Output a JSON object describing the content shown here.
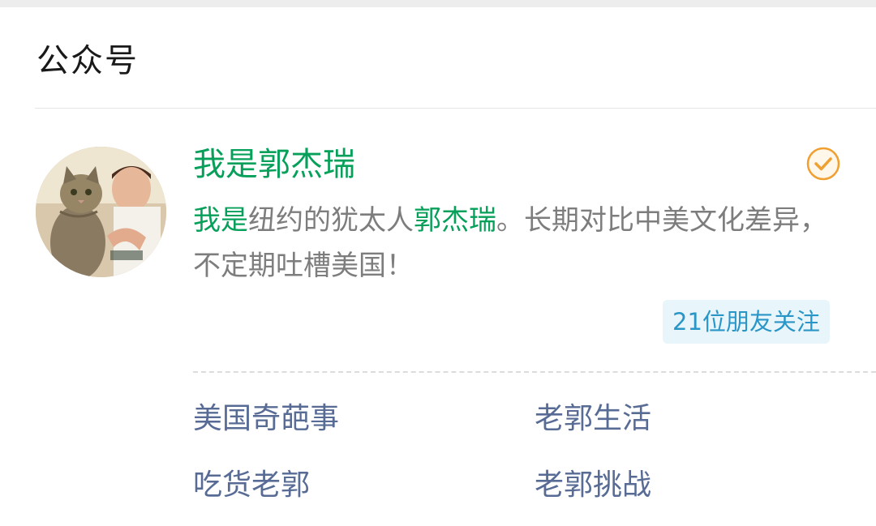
{
  "section": {
    "title": "公众号"
  },
  "account": {
    "name": "我是郭杰瑞",
    "description": {
      "hl1": "我是",
      "part2": "纽约的犹太人",
      "hl2": "郭杰瑞",
      "part4": "。长期对比中美文化差异，不定期吐槽美国！"
    },
    "followers_badge": "21位朋友关注",
    "verified_icon": "verified-check-icon",
    "avatar": "avatar-photo"
  },
  "menu": {
    "items": [
      {
        "label": "美国奇葩事"
      },
      {
        "label": "老郭生活"
      },
      {
        "label": "吃货老郭"
      },
      {
        "label": "老郭挑战"
      }
    ]
  },
  "colors": {
    "name_green": "#07a05a",
    "link_blue": "#576b95",
    "badge_bg": "#e8f5fb",
    "badge_text": "#2a96c8",
    "verified_orange": "#f0a030"
  }
}
